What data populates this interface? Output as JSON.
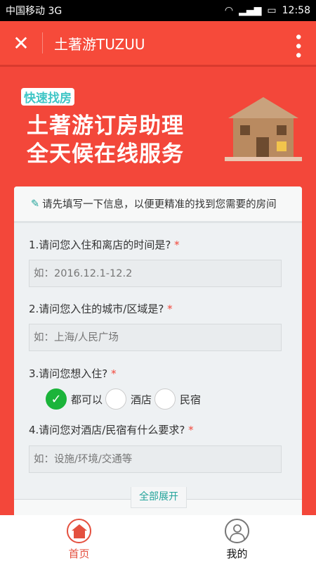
{
  "status": {
    "carrier": "中国移动 3G",
    "time": "12:58",
    "network": "3G"
  },
  "titlebar": {
    "title": "土著游TUZUU"
  },
  "banner": {
    "tag": "快速找房",
    "line1": "土著游订房助理",
    "line2": "全天候在线服务"
  },
  "form": {
    "intro": "请先填写一下信息，以便更精准的找到您需要的房间",
    "q1": "1.请问您入住和离店的时间是?",
    "q1_placeholder": "如：2016.12.1-12.2",
    "q2": "2.请问您入住的城市/区域是?",
    "q2_placeholder": "如：上海/人民广场",
    "q3": "3.请问您想入住?",
    "q3_options": [
      "都可以",
      "酒店",
      "民宿"
    ],
    "q3_selected": "都可以",
    "q4": "4.请问您对酒店/民宿有什么要求?",
    "q4_placeholder": "如：设施/环境/交通等",
    "required": "*",
    "expand": "全部展开"
  },
  "nav": {
    "home": "首页",
    "mine": "我的",
    "accent": "#e4503f"
  }
}
